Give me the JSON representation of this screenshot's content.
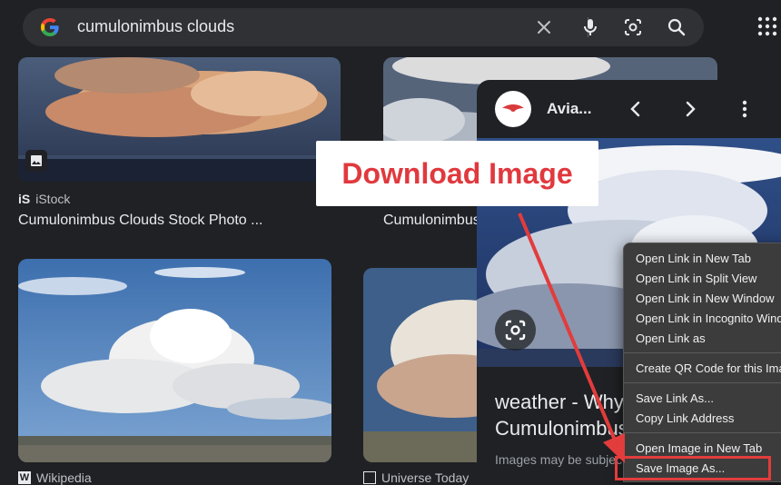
{
  "search": {
    "query": "cumulonimbus clouds"
  },
  "results": [
    {
      "source": "iStock",
      "caption": "Cumulonimbus Clouds Stock Photo ..."
    },
    {
      "source": "",
      "caption": "Cumulonimbus"
    },
    {
      "source": "Wikipedia",
      "caption": ""
    },
    {
      "source": "Universe Today",
      "caption": ""
    }
  ],
  "panel": {
    "site": "Avia...",
    "title_line1": "weather - Why",
    "title_line2": "Cumulonimbus",
    "note": "Images may be subject to copyright"
  },
  "context_menu": {
    "group1": [
      "Open Link in New Tab",
      "Open Link in Split View",
      "Open Link in New Window",
      "Open Link in Incognito Window",
      "Open Link as"
    ],
    "group2": [
      "Create QR Code for this Image"
    ],
    "group3": [
      "Save Link As...",
      "Copy Link Address"
    ],
    "group4": [
      "Open Image in New Tab",
      "Save Image As..."
    ]
  },
  "annotation": {
    "label": "Download Image",
    "color": "#e0393e"
  },
  "colors": {
    "background": "#202124",
    "searchbar": "#303134",
    "menu": "#3c3c3c",
    "accent_red": "#e23c3c"
  },
  "icons": [
    "google-g-icon",
    "clear-icon",
    "microphone-icon",
    "lens-icon",
    "search-icon",
    "apps-grid-icon",
    "image-badge-icon",
    "chevron-left-icon",
    "chevron-right-icon",
    "more-vert-icon"
  ]
}
